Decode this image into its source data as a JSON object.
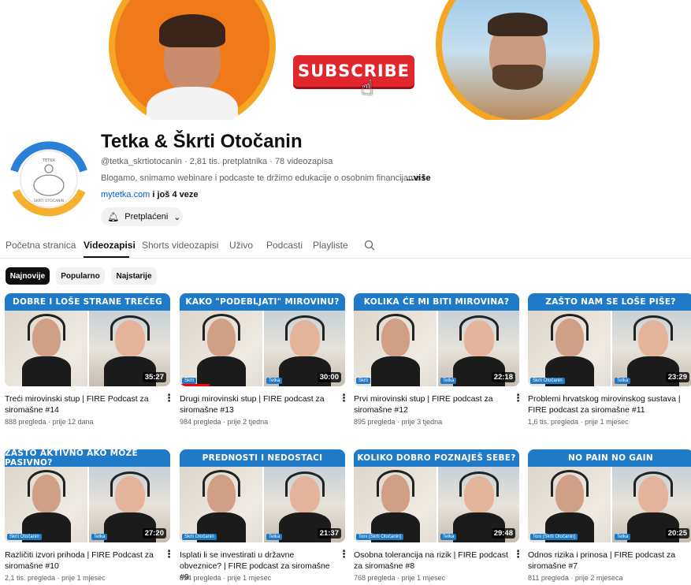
{
  "banner": {
    "subscribe_label": "SUBSCRIBE",
    "colors": {
      "ring": "#f5a623",
      "button": "#e1262d"
    }
  },
  "channel": {
    "title": "Tetka & Škrti Otočanin",
    "handle": "@tetka_skrtiotocanin",
    "subscribers": "2,81 tis. pretplatnika",
    "videos": "78 videozapisa",
    "separator": "·",
    "description": "Blogamo, snimamo webinare i podcaste te držimo edukacije o osobnim financijama i",
    "more_label": "...više",
    "link": "mytetka.com",
    "extra_links": " i još 4 veze",
    "subscribed_label": "Pretplaćeni",
    "avatar_text": [
      "TETKA",
      "ŠKRTI OTOČANIN"
    ]
  },
  "tabs": [
    {
      "label": "Početna stranica"
    },
    {
      "label": "Videozapisi"
    },
    {
      "label": "Shorts videozapisi"
    },
    {
      "label": "Uživo"
    },
    {
      "label": "Podcasti"
    },
    {
      "label": "Playliste"
    }
  ],
  "chips": [
    {
      "label": "Najnovije"
    },
    {
      "label": "Popularno"
    },
    {
      "label": "Najstarije"
    }
  ],
  "videos": [
    {
      "banner": "DOBRE I LOŠE STRANE TREĆEG",
      "duration": "35:27",
      "title": "Treći mirovinski stup | FIRE Podcast za siromašne #14",
      "views": "888 pregleda",
      "age": "prije 12 dana",
      "tags": [],
      "progress": 0
    },
    {
      "banner": "KAKO \"PODEBLJATI\" MIROVINU?",
      "duration": "30:00",
      "title": "Drugi mirovinski stup | FIRE podcast za siromašne #13",
      "views": "984 pregleda",
      "age": "prije 2 tjedna",
      "tags": [
        "Škrti",
        "Tetka"
      ],
      "progress": 0.18
    },
    {
      "banner": "KOLIKA ĆE MI BITI MIROVINA?",
      "duration": "22:18",
      "title": "Prvi mirovinski stup | FIRE podcast za siromašne #12",
      "views": "895 pregleda",
      "age": "prije 3 tjedna",
      "tags": [
        "Škrti",
        "Tetka"
      ],
      "progress": 0
    },
    {
      "banner": "ZAŠTO NAM SE LOŠE PIŠE?",
      "duration": "23:29",
      "title": "Problemi hrvatskog mirovinskog sustava | FIRE podcast za siromašne #11",
      "views": "1,6 tis. pregleda",
      "age": "prije 1 mjesec",
      "tags": [
        "Škrti Otočanin",
        "Tetka"
      ],
      "progress": 0
    },
    {
      "banner": "ZAŠTO AKTIVNO AKO MOŽE PASIVNO?",
      "duration": "27:20",
      "title": "Različiti izvori prihoda | FIRE Podcast za siromašne #10",
      "views": "2,1 tis. pregleda",
      "age": "prije 1 mjesec",
      "tags": [
        "Škrti Otočanin",
        "Tetka"
      ],
      "progress": 0
    },
    {
      "banner": "PREDNOSTI I NEDOSTACI",
      "duration": "21:37",
      "title": "Isplati li se investirati u državne obveznice? | FIRE podcast za siromašne #9",
      "views": "894 pregleda",
      "age": "prije 1 mjesec",
      "tags": [
        "Škrti Otočanin",
        "Tetka"
      ],
      "progress": 0
    },
    {
      "banner": "KOLIKO DOBRO POZNAJEŠ SEBE?",
      "duration": "29:48",
      "title": "Osobna tolerancija na rizik | FIRE podcast za siromašne #8",
      "views": "768 pregleda",
      "age": "prije 1 mjesec",
      "tags": [
        "Toni (Škrti Otočanin)",
        "Tetka"
      ],
      "progress": 0
    },
    {
      "banner": "NO PAIN NO GAIN",
      "duration": "20:25",
      "title": "Odnos rizika i prinosa | FIRE podcast za siromašne #7",
      "views": "811 pregleda",
      "age": "prije 2 mjeseca",
      "tags": [
        "Toni (Škrti Otočanin)",
        "Tetka"
      ],
      "progress": 0
    }
  ],
  "meta_separator": "·",
  "colors": {
    "link": "#065fd4",
    "thumb_banner": "#1f7ac8",
    "progress": "#ff0000"
  }
}
